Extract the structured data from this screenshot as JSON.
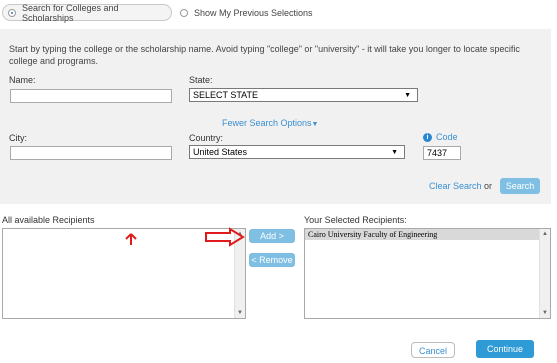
{
  "mode": {
    "option1": "Search for Colleges and Scholarships",
    "option2": "Show My Previous Selections"
  },
  "search": {
    "instructions": "Start by typing the college or the scholarship name. Avoid typing \"college\" or \"university\" - it will take you longer to locate specific college and programs.",
    "name_label": "Name:",
    "name_value": "",
    "state_label": "State:",
    "state_value": "SELECT STATE",
    "fewer_options": "Fewer Search Options",
    "city_label": "City:",
    "city_value": "",
    "country_label": "Country:",
    "country_value": "United States",
    "code_label": "Code",
    "code_value": "7437",
    "clear_label": "Clear Search",
    "or_text": "or",
    "search_label": "Search"
  },
  "recipients": {
    "available_label": "All available Recipients",
    "add_label": "Add >",
    "remove_label": "< Remove",
    "selected_label": "Your Selected Recipients:",
    "selected_items": [
      "Cairo University Faculty of Engineering"
    ]
  },
  "footer": {
    "cancel_label": "Cancel",
    "continue_label": "Continue"
  },
  "colors": {
    "accent": "#2e9ad6",
    "link": "#3a8fd1",
    "annotation": "#e01b1b"
  }
}
